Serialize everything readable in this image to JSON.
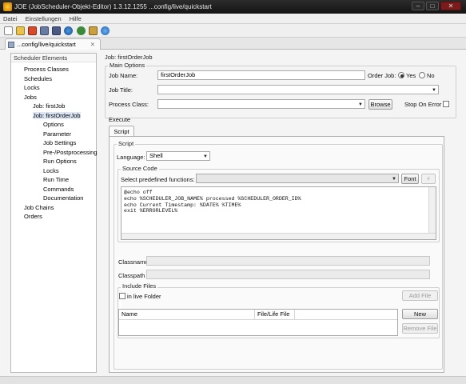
{
  "window": {
    "title": "JOE (JobScheduler-Objekt-Editor) 1.3.12.1255 ...config/live/quickstart"
  },
  "menu": [
    "Datei",
    "Einstellungen",
    "Hilfe"
  ],
  "toolbar": [
    "new-icon",
    "open-icon",
    "open-folder-icon",
    "save-icon",
    "save-all-icon",
    "globe-icon",
    "refresh-icon",
    "tools-icon",
    "info-icon"
  ],
  "editor_tab": {
    "label": "...config/live/quickstart",
    "close": "✕"
  },
  "tree": {
    "header": "Scheduler Elements",
    "nodes": [
      {
        "label": "Process Classes",
        "indent": 1
      },
      {
        "label": "Schedules",
        "indent": 1
      },
      {
        "label": "Locks",
        "indent": 1
      },
      {
        "label": "Jobs",
        "indent": 1
      },
      {
        "label": "Job: firstJob",
        "indent": 2
      },
      {
        "label": "Job: firstOrderJob",
        "indent": 2
      },
      {
        "label": "Options",
        "indent": 3
      },
      {
        "label": "Parameter",
        "indent": 3
      },
      {
        "label": "Job Settings",
        "indent": 3
      },
      {
        "label": "Pre-/Postprocessing",
        "indent": 3
      },
      {
        "label": "Run Options",
        "indent": 3
      },
      {
        "label": "Locks",
        "indent": 3
      },
      {
        "label": "Run Time",
        "indent": 3
      },
      {
        "label": "Commands",
        "indent": 3
      },
      {
        "label": "Documentation",
        "indent": 3
      },
      {
        "label": "Job Chains",
        "indent": 1
      },
      {
        "label": "Orders",
        "indent": 1
      }
    ]
  },
  "job": {
    "panel_title": "Job: firstOrderJob",
    "main_options_label": "Main Options",
    "job_name_label": "Job Name:",
    "job_name_value": "firstOrderJob",
    "order_job_label": "Order Job:",
    "order_yes": "Yes",
    "order_no": "No",
    "job_title_label": "Job Title:",
    "job_title_value": "",
    "process_class_label": "Process Class:",
    "process_class_value": "",
    "browse_label": "Browse",
    "stop_on_error_label": "Stop On Error"
  },
  "execute": {
    "group_label": "Execute",
    "tab_label": "Script",
    "script_group_label": "Script",
    "language_label": "Language:",
    "language_value": "Shell",
    "source_code_label": "Source Code",
    "predefined_label": "Select predefined functions:",
    "predefined_value": "",
    "font_button": "Font",
    "code_lines": [
      "@echo off",
      "echo %SCHEDULER_JOB_NAME% processed %SCHEDULER_ORDER_ID%",
      "echo Current Timestamp: %DATE% %TIME%",
      "exit %ERRORLEVEL%"
    ],
    "classname_label": "Classname",
    "classpath_label": "Classpath",
    "include_files_label": "Include Files",
    "in_live_folder_label": "in live Folder",
    "add_file_label": "Add File",
    "table_headers": [
      "Name",
      "File/Life File"
    ],
    "new_label": "New",
    "remove_file_label": "Remove File"
  }
}
